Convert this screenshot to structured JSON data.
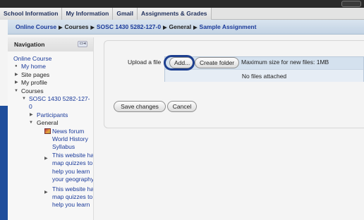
{
  "tabs": [
    "School Information",
    "My Information",
    "Gmail",
    "Assignments & Grades"
  ],
  "breadcrumb": {
    "items": [
      "Online Course",
      "Courses",
      "SOSC 1430 5282-127-0",
      "General",
      "Sample Assignment"
    ],
    "separator": "▶"
  },
  "navigation": {
    "title": "Navigation",
    "items": [
      {
        "label": "Online Course",
        "link": true
      },
      {
        "label": "My home",
        "link": true
      },
      {
        "label": "Site pages",
        "link": false
      },
      {
        "label": "My profile",
        "link": false
      },
      {
        "label": "Courses",
        "link": false
      },
      {
        "label": "SOSC 1430 5282-127-",
        "label2": "0",
        "link": true
      },
      {
        "label": "Participants",
        "link": true
      },
      {
        "label": "General",
        "link": false
      },
      {
        "label": "News forum",
        "link": true
      },
      {
        "label": "World History",
        "label2": "Syllabus",
        "link": true
      },
      {
        "label": "This website has",
        "label2": "map quizzes to",
        "label3": "help you learn",
        "label4": "your geography",
        "link": true
      },
      {
        "label": "This website has",
        "label2": "map quizzes to",
        "label3": "help you learn",
        "link": true
      }
    ]
  },
  "upload": {
    "label": "Upload a file",
    "add_label": "Add...",
    "create_folder_label": "Create folder",
    "max_size_text": "Maximum size for new files: 1MB",
    "no_files_text": "No files attached"
  },
  "actions": {
    "save_label": "Save changes",
    "cancel_label": "Cancel"
  },
  "colors": {
    "link": "#1a3a9a",
    "highlight_ring": "#1d3f8f",
    "file_panel": "#d4e1ee"
  }
}
